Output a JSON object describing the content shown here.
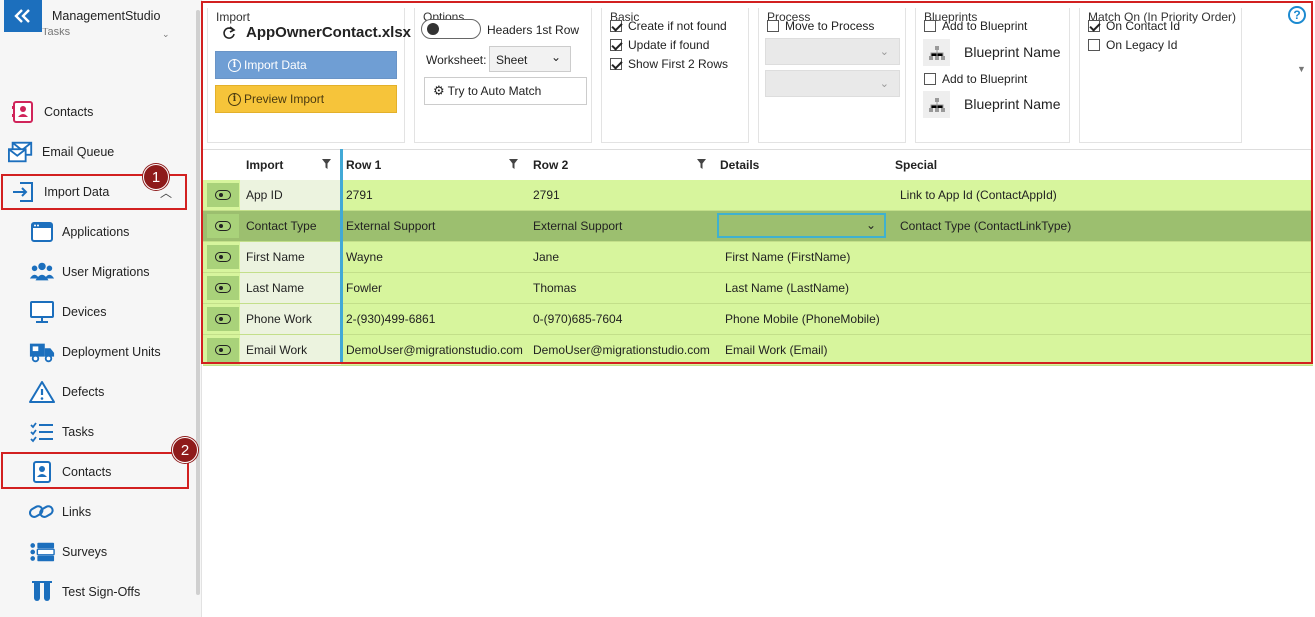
{
  "app": {
    "name": "ManagementStudio",
    "tasks_partial": "Tasks"
  },
  "sidebar": {
    "top_items": [
      {
        "label": "Contacts"
      },
      {
        "label": "Email Queue"
      },
      {
        "label": "Import Data"
      }
    ],
    "sub_items": [
      {
        "label": "Applications"
      },
      {
        "label": "User Migrations"
      },
      {
        "label": "Devices"
      },
      {
        "label": "Deployment Units"
      },
      {
        "label": "Defects"
      },
      {
        "label": "Tasks"
      },
      {
        "label": "Contacts"
      },
      {
        "label": "Links"
      },
      {
        "label": "Surveys"
      },
      {
        "label": "Test Sign-Offs"
      }
    ]
  },
  "annotations": {
    "badge1": "1",
    "badge2": "2"
  },
  "panels": {
    "import": {
      "title": "Import",
      "file": "AppOwnerContact.xlsx",
      "import_btn": "Import Data",
      "preview_btn": "Preview Import"
    },
    "options": {
      "title": "Options",
      "headers_label": "Headers 1st Row",
      "worksheet_label": "Worksheet:",
      "worksheet_value": "Sheet",
      "auto_match": "Try to Auto Match"
    },
    "basic": {
      "title": "Basic",
      "create": "Create if not found",
      "update": "Update if found",
      "show_first": "Show First 2 Rows"
    },
    "process": {
      "title": "Process",
      "move": "Move to Process"
    },
    "blueprints": {
      "title": "Blueprints",
      "add1": "Add to Blueprint",
      "name1": "Blueprint Name",
      "add2": "Add to Blueprint",
      "name2": "Blueprint Name"
    },
    "match": {
      "title": "Match On (In Priority Order)",
      "contact_id": "On Contact Id",
      "legacy_id": "On Legacy Id"
    }
  },
  "grid": {
    "headers": {
      "import": "Import",
      "row1": "Row 1",
      "row2": "Row 2",
      "details": "Details",
      "special": "Special"
    },
    "rows": [
      {
        "name": "App ID",
        "row1": "2791",
        "row2": "2791",
        "details": "",
        "special": "Link to App Id (ContactAppId)"
      },
      {
        "name": "Contact Type",
        "row1": "External Support",
        "row2": "External Support",
        "details": "",
        "special": "Contact Type (ContactLinkType)"
      },
      {
        "name": "First Name",
        "row1": "Wayne",
        "row2": "Jane",
        "details": "First Name (FirstName)",
        "special": ""
      },
      {
        "name": "Last Name",
        "row1": "Fowler",
        "row2": "Thomas",
        "details": "Last Name (LastName)",
        "special": ""
      },
      {
        "name": "Phone Work",
        "row1": "2-(930)499-6861",
        "row2": "0-(970)685-7604",
        "details": "Phone Mobile (PhoneMobile)",
        "special": ""
      },
      {
        "name": "Email Work",
        "row1": "DemoUser@migrationstudio.com",
        "row2": "DemoUser@migrationstudio.com",
        "details": "Email Work (Email)",
        "special": ""
      }
    ]
  },
  "colors": {
    "accent": "#1c6fbd",
    "row_green": "#d7f59d",
    "row_selected": "#9cbf6f",
    "highlight": "#d22020",
    "badge": "#8e1b1b",
    "import_btn": "#6f9ed4",
    "preview_btn": "#f6c43a"
  }
}
